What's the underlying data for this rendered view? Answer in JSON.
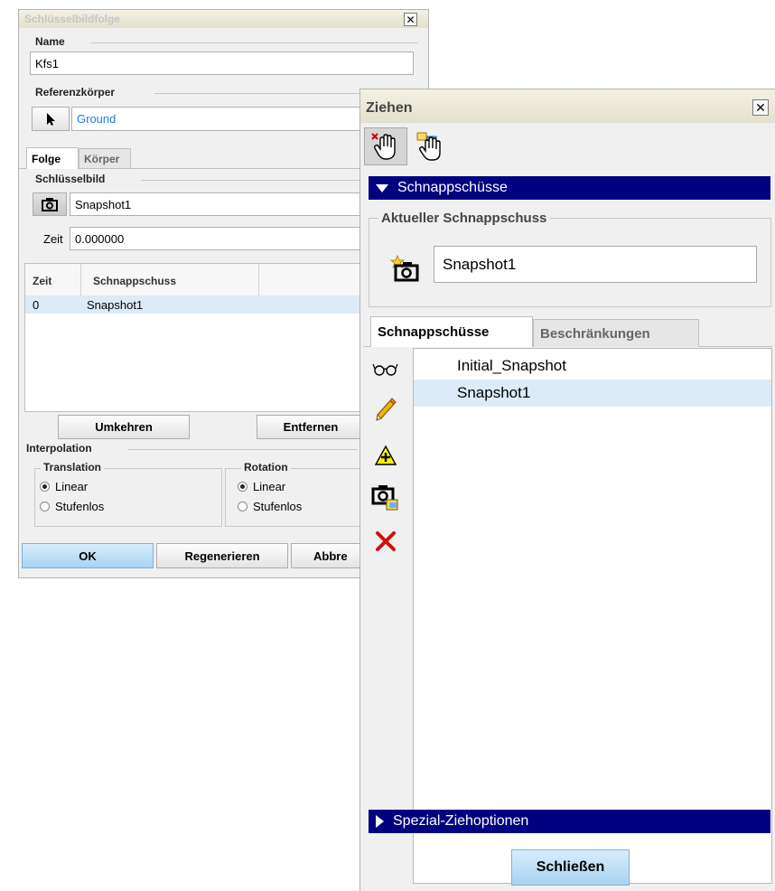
{
  "left_dialog": {
    "title": "Schlüsselbildfolge",
    "name_label": "Name",
    "name_value": "Kfs1",
    "ref_label": "Referenzkörper",
    "ref_value": "Ground",
    "tabs": [
      {
        "label": "Folge"
      },
      {
        "label": "Körper"
      }
    ],
    "keyframe_label": "Schlüsselbild",
    "keyframe_value": "Snapshot1",
    "time_label": "Zeit",
    "time_value": "0.000000",
    "table": {
      "headers": [
        "Zeit",
        "Schnappschuss"
      ],
      "rows": [
        {
          "time": "0",
          "snapshot": "Snapshot1"
        }
      ]
    },
    "reverse_label": "Umkehren",
    "remove_label": "Entfernen",
    "interp_label": "Interpolation",
    "translation_label": "Translation",
    "rotation_label": "Rotation",
    "linear_label": "Linear",
    "smooth_label": "Stufenlos",
    "ok_label": "OK",
    "regen_label": "Regenerieren",
    "cancel_label": "Abbre"
  },
  "right_dialog": {
    "title": "Ziehen",
    "snapshots_bar": "Schnappschüsse",
    "current_group": "Aktueller Schnappschuss",
    "current_value": "Snapshot1",
    "tabs": [
      {
        "label": "Schnappschüsse"
      },
      {
        "label": "Beschränkungen"
      }
    ],
    "list": [
      "Initial_Snapshot",
      "Snapshot1"
    ],
    "special_bar": "Spezial-Ziehoptionen",
    "close_label": "Schließen"
  },
  "colors": {
    "accent_bar": "#000080",
    "selection": "#dcebf7",
    "ground_link": "#1b7fd6"
  }
}
